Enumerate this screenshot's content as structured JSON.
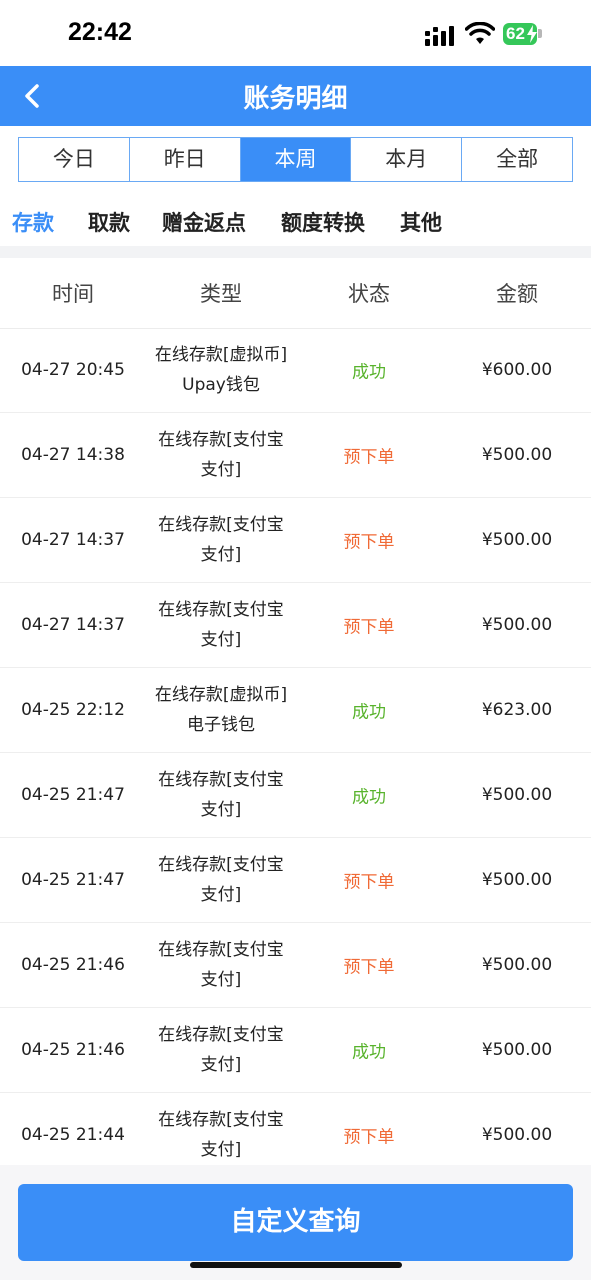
{
  "status_bar": {
    "time": "22:42",
    "battery": "62"
  },
  "header": {
    "title": "账务明细"
  },
  "periods": [
    "今日",
    "昨日",
    "本周",
    "本月",
    "全部"
  ],
  "active_period": "本周",
  "categories": [
    "存款",
    "取款",
    "赠金返点",
    "额度转换",
    "其他"
  ],
  "active_category": "存款",
  "table": {
    "headers": [
      "时间",
      "类型",
      "状态",
      "金额"
    ],
    "rows": [
      {
        "time": "04-27 20:45",
        "type": "在线存款[虚拟币]Upay钱包",
        "status": "成功",
        "amount": "¥600.00"
      },
      {
        "time": "04-27 14:38",
        "type": "在线存款[支付宝支付]",
        "status": "预下单",
        "amount": "¥500.00"
      },
      {
        "time": "04-27 14:37",
        "type": "在线存款[支付宝支付]",
        "status": "预下单",
        "amount": "¥500.00"
      },
      {
        "time": "04-27 14:37",
        "type": "在线存款[支付宝支付]",
        "status": "预下单",
        "amount": "¥500.00"
      },
      {
        "time": "04-25 22:12",
        "type": "在线存款[虚拟币]电子钱包",
        "status": "成功",
        "amount": "¥623.00"
      },
      {
        "time": "04-25 21:47",
        "type": "在线存款[支付宝支付]",
        "status": "成功",
        "amount": "¥500.00"
      },
      {
        "time": "04-25 21:47",
        "type": "在线存款[支付宝支付]",
        "status": "预下单",
        "amount": "¥500.00"
      },
      {
        "time": "04-25 21:46",
        "type": "在线存款[支付宝支付]",
        "status": "预下单",
        "amount": "¥500.00"
      },
      {
        "time": "04-25 21:46",
        "type": "在线存款[支付宝支付]",
        "status": "成功",
        "amount": "¥500.00"
      },
      {
        "time": "04-25 21:44",
        "type": "在线存款[支付宝支付]",
        "status": "预下单",
        "amount": "¥500.00"
      }
    ]
  },
  "status_colors": {
    "成功": "#58b32c",
    "预下单": "#f06a36"
  },
  "accent_color": "#3a8ef7",
  "footer": {
    "query_label": "自定义查询"
  }
}
